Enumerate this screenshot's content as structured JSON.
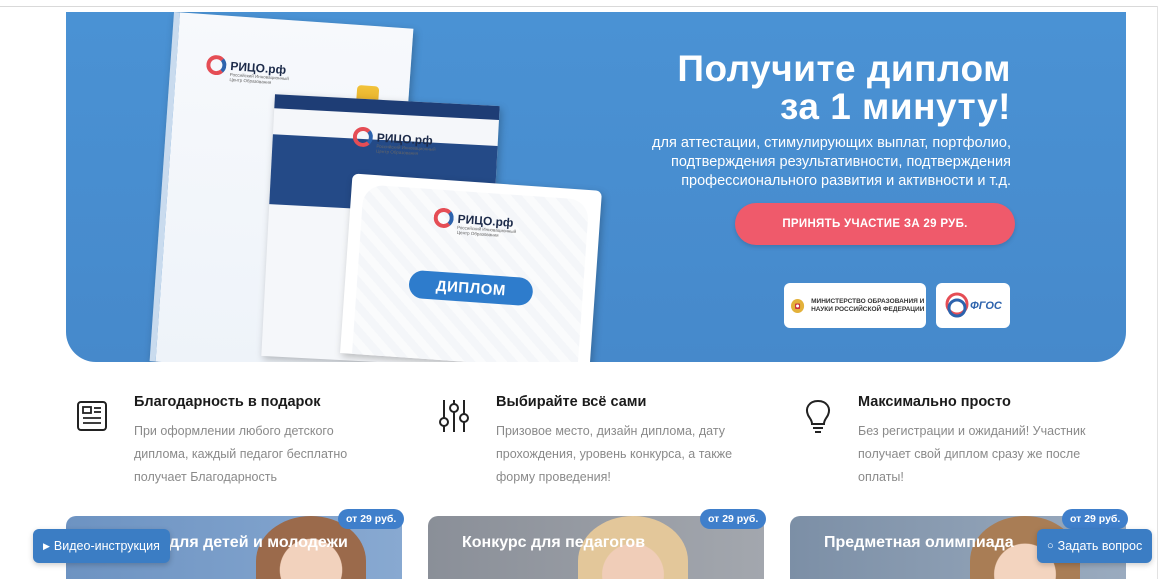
{
  "hero": {
    "title_line1": "Получите диплом",
    "title_line2": "за 1 минуту!",
    "subtitle": "для аттестации, стимулирующих выплат, портфолио, подтверждения результативности, подтверждения профессионального развития и активности и т.д.",
    "cta_label": "ПРИНЯТЬ УЧАСТИЕ ЗА 29 РУБ.",
    "ministry_badge": "МИНИСТЕРСТВО ОБРАЗОВАНИЯ И НАУКИ РОССИЙСКОЙ ФЕДЕРАЦИИ",
    "fgos_badge": "ФГОС",
    "diploma_logo": "РИЦО.рф",
    "diploma_logo_sub": "Российский Инновационный Центр Образования",
    "diploma_pill": "ДИПЛОМ"
  },
  "features": [
    {
      "icon": "document-icon",
      "title": "Благодарность в подарок",
      "text": "При оформлении любого детского диплома, каждый педагог бесплатно получает Благодарность"
    },
    {
      "icon": "sliders-icon",
      "title": "Выбирайте всё сами",
      "text": "Призовое место, дизайн диплома, дату прохождения, уровень конкурса, а также форму проведения!"
    },
    {
      "icon": "lightbulb-icon",
      "title": "Максимально просто",
      "text": "Без регистрации и ожиданий! Участник получает свой диплом сразу же после оплаты!"
    }
  ],
  "cards": [
    {
      "title": "Конкурс для детей и молодежи",
      "price": "от 29 руб."
    },
    {
      "title": "Конкурс для педагогов",
      "price": "от 29 руб."
    },
    {
      "title": "Предметная олимпиада",
      "price": "от 29 руб."
    }
  ],
  "floating": {
    "video_label": "Видео-инструкция",
    "question_label": "Задать вопрос"
  },
  "colors": {
    "hero_blue": "#4a92d4",
    "cta_red": "#ef5a6b",
    "button_blue": "#3b7dc4"
  }
}
